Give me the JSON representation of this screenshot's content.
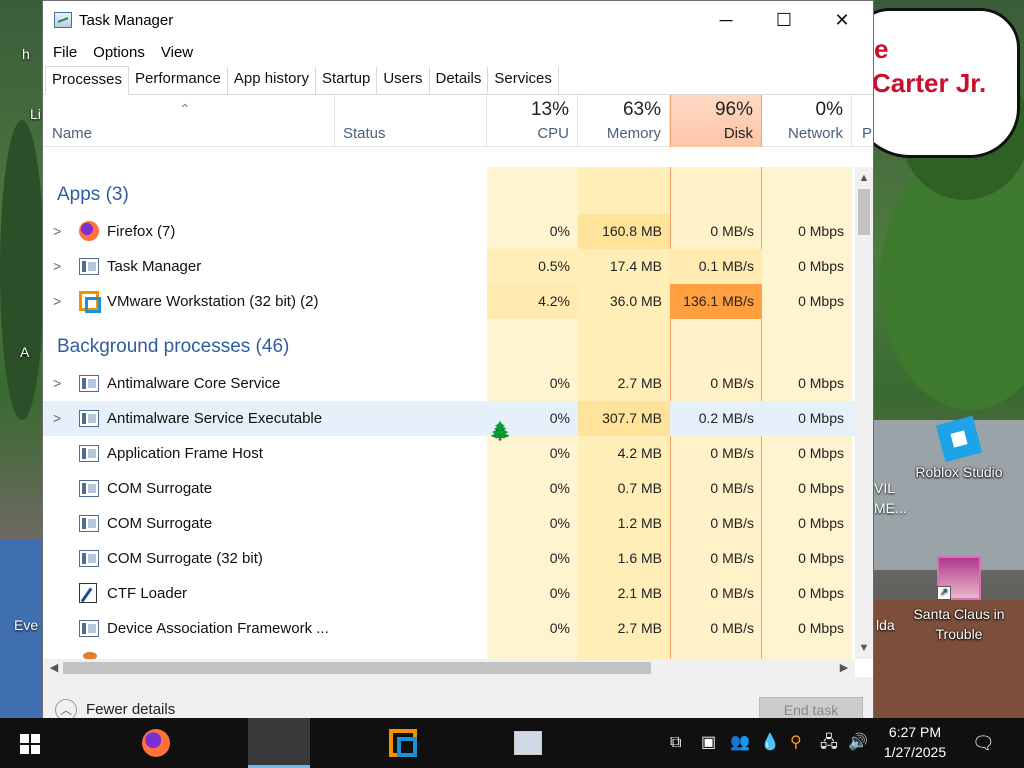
{
  "window": {
    "title": "Task Manager",
    "minimize": "─",
    "maximize": "☐",
    "close": "✕"
  },
  "menu": [
    "File",
    "Options",
    "View"
  ],
  "tabs": [
    "Processes",
    "Performance",
    "App history",
    "Startup",
    "Users",
    "Details",
    "Services"
  ],
  "columns": {
    "name": "Name",
    "status": "Status",
    "cpu": {
      "pct": "13%",
      "label": "CPU"
    },
    "memory": {
      "pct": "63%",
      "label": "Memory"
    },
    "disk": {
      "pct": "96%",
      "label": "Disk"
    },
    "network": {
      "pct": "0%",
      "label": "Network"
    },
    "power_partial": "P"
  },
  "groups": {
    "apps": "Apps (3)",
    "background": "Background processes (46)"
  },
  "apps": [
    {
      "name": "Firefox (7)",
      "cpu": "0%",
      "mem": "160.8 MB",
      "disk": "0 MB/s",
      "net": "0 Mbps",
      "icon": "firefox-icon"
    },
    {
      "name": "Task Manager",
      "cpu": "0.5%",
      "mem": "17.4 MB",
      "disk": "0.1 MB/s",
      "net": "0 Mbps",
      "icon": "task-manager-icon"
    },
    {
      "name": "VMware Workstation (32 bit) (2)",
      "cpu": "4.2%",
      "mem": "36.0 MB",
      "disk": "136.1 MB/s",
      "net": "0 Mbps",
      "icon": "vmware-icon"
    }
  ],
  "background": [
    {
      "name": "Antimalware Core Service",
      "cpu": "0%",
      "mem": "2.7 MB",
      "disk": "0 MB/s",
      "net": "0 Mbps",
      "expand": true
    },
    {
      "name": "Antimalware Service Executable",
      "cpu": "0%",
      "mem": "307.7 MB",
      "disk": "0.2 MB/s",
      "net": "0 Mbps",
      "expand": true
    },
    {
      "name": "Application Frame Host",
      "cpu": "0%",
      "mem": "4.2 MB",
      "disk": "0 MB/s",
      "net": "0 Mbps",
      "expand": false
    },
    {
      "name": "COM Surrogate",
      "cpu": "0%",
      "mem": "0.7 MB",
      "disk": "0 MB/s",
      "net": "0 Mbps",
      "expand": false
    },
    {
      "name": "COM Surrogate",
      "cpu": "0%",
      "mem": "1.2 MB",
      "disk": "0 MB/s",
      "net": "0 Mbps",
      "expand": false
    },
    {
      "name": "COM Surrogate (32 bit)",
      "cpu": "0%",
      "mem": "1.6 MB",
      "disk": "0 MB/s",
      "net": "0 Mbps",
      "expand": false
    },
    {
      "name": "CTF Loader",
      "cpu": "0%",
      "mem": "2.1 MB",
      "disk": "0 MB/s",
      "net": "0 Mbps",
      "expand": false
    },
    {
      "name": "Device Association Framework ...",
      "cpu": "0%",
      "mem": "2.7 MB",
      "disk": "0 MB/s",
      "net": "0 Mbps",
      "expand": false
    }
  ],
  "footer": {
    "fewer_details": "Fewer details",
    "end_task": "End task"
  },
  "desktop": {
    "bubble_line1": "e",
    "bubble_line2": "Carter Jr.",
    "icons": [
      {
        "label": "Roblox Studio"
      },
      {
        "label": "Santa Claus in Trouble"
      }
    ],
    "partial_labels": [
      "Li",
      "h",
      "A",
      "Eve",
      "VIL",
      "ME...",
      "lda"
    ]
  },
  "taskbar": {
    "time": "6:27 PM",
    "date": "1/27/2025"
  },
  "colors": {
    "disk_hot": "#ff9f40",
    "disk_header": "#ffc4a6",
    "accent": "#2f5da1"
  }
}
